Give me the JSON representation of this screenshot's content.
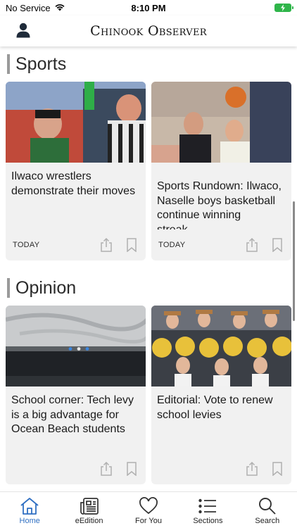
{
  "status_bar": {
    "carrier": "No Service",
    "time": "8:10 PM"
  },
  "header": {
    "brand": "Chinook Observer"
  },
  "sections": [
    {
      "title": "Sports",
      "cards": [
        {
          "title": "Ilwaco wrestlers demonstrate their moves",
          "time": "TODAY"
        },
        {
          "title": "Sports Rundown: Ilwaco, Naselle boys basketball continue winning streak,…",
          "time": "TODAY"
        }
      ]
    },
    {
      "title": "Opinion",
      "cards": [
        {
          "title": "School corner: Tech levy is a big advantage for Ocean Beach students",
          "time": ""
        },
        {
          "title": "Editorial: Vote to renew school levies",
          "time": ""
        }
      ]
    }
  ],
  "tabs": [
    {
      "label": "Home",
      "icon": "home-icon",
      "active": true
    },
    {
      "label": "eEdition",
      "icon": "newspaper-icon",
      "active": false
    },
    {
      "label": "For You",
      "icon": "heart-icon",
      "active": false
    },
    {
      "label": "Sections",
      "icon": "list-icon",
      "active": false
    },
    {
      "label": "Search",
      "icon": "search-icon",
      "active": false
    }
  ],
  "colors": {
    "accent": "#2f6fc2",
    "card_bg": "#f1f1f1",
    "battery": "#2fb54a"
  }
}
